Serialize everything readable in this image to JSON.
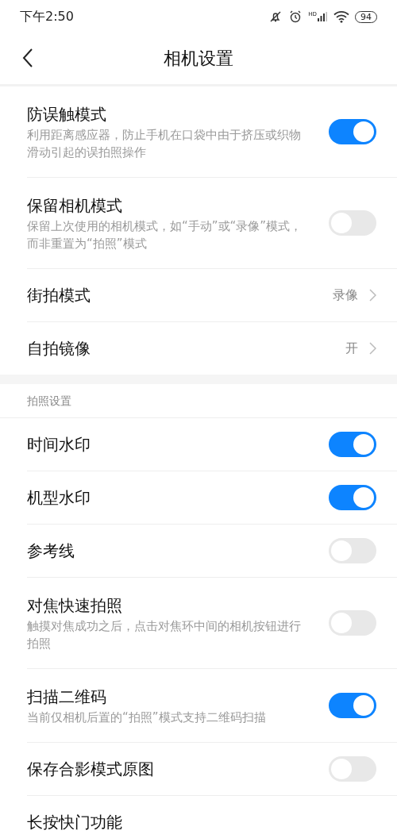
{
  "status_bar": {
    "time": "下午2:50",
    "network_label": "HD",
    "battery": "94"
  },
  "header": {
    "title": "相机设置"
  },
  "groups": [
    {
      "items": [
        {
          "kind": "toggle",
          "title": "防误触模式",
          "description": "利用距离感应器，防止手机在口袋中由于挤压或织物滑动引起的误拍照操作",
          "on": true
        },
        {
          "kind": "toggle",
          "title": "保留相机模式",
          "description": "保留上次使用的相机模式，如“手动”或“录像”模式，而非重置为“拍照”模式",
          "on": false
        },
        {
          "kind": "link",
          "title": "街拍模式",
          "value": "录像"
        },
        {
          "kind": "link",
          "title": "自拍镜像",
          "value": "开"
        }
      ]
    },
    {
      "heading": "拍照设置",
      "items": [
        {
          "kind": "toggle",
          "title": "时间水印",
          "on": true
        },
        {
          "kind": "toggle",
          "title": "机型水印",
          "on": true
        },
        {
          "kind": "toggle",
          "title": "参考线",
          "on": false
        },
        {
          "kind": "toggle",
          "title": "对焦快速拍照",
          "description": "触摸对焦成功之后，点击对焦环中间的相机按钮进行拍照",
          "on": false
        },
        {
          "kind": "toggle",
          "title": "扫描二维码",
          "description": "当前仅相机后置的“拍照”模式支持二维码扫描",
          "on": true
        },
        {
          "kind": "toggle",
          "title": "保存合影模式原图",
          "on": false
        },
        {
          "kind": "plain",
          "title": "长按快门功能"
        }
      ]
    }
  ]
}
